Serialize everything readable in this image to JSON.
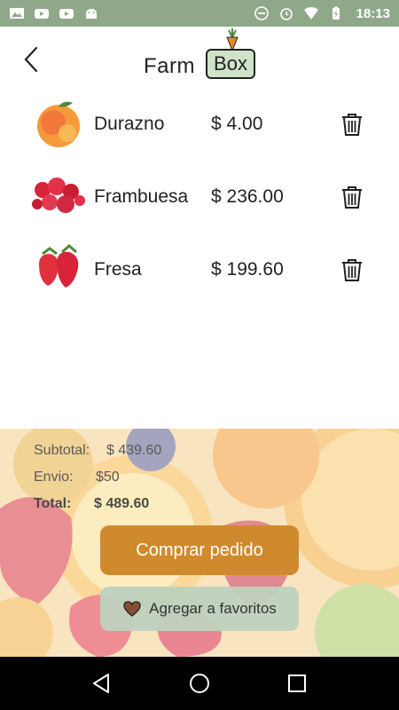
{
  "status_bar": {
    "time": "18:13",
    "left_icons": [
      "image-icon",
      "youtube-icon",
      "youtube-icon",
      "android-icon"
    ],
    "right_icons": [
      "do-not-disturb-icon",
      "alarm-icon",
      "wifi-icon",
      "battery-icon"
    ]
  },
  "header": {
    "logo_farm": "Farm",
    "logo_box": "Box"
  },
  "products": [
    {
      "name": "Durazno",
      "price": "$ 4.00",
      "image": "peach"
    },
    {
      "name": "Frambuesa",
      "price": "$ 236.00",
      "image": "raspberry"
    },
    {
      "name": "Fresa",
      "price": "$ 199.60",
      "image": "strawberry"
    }
  ],
  "summary": {
    "subtotal_label": "Subtotal:",
    "subtotal_value": "$ 439.60",
    "envio_label": "Envio:",
    "envio_value": "$50",
    "total_label": "Total:",
    "total_value": "$ 489.60"
  },
  "actions": {
    "buy_label": "Comprar pedido",
    "favorites_label": "Agregar a favoritos"
  },
  "colors": {
    "status_bar": "#8fa88a",
    "buy_button": "#d08a2e",
    "favorites_button": "#bed2be"
  }
}
